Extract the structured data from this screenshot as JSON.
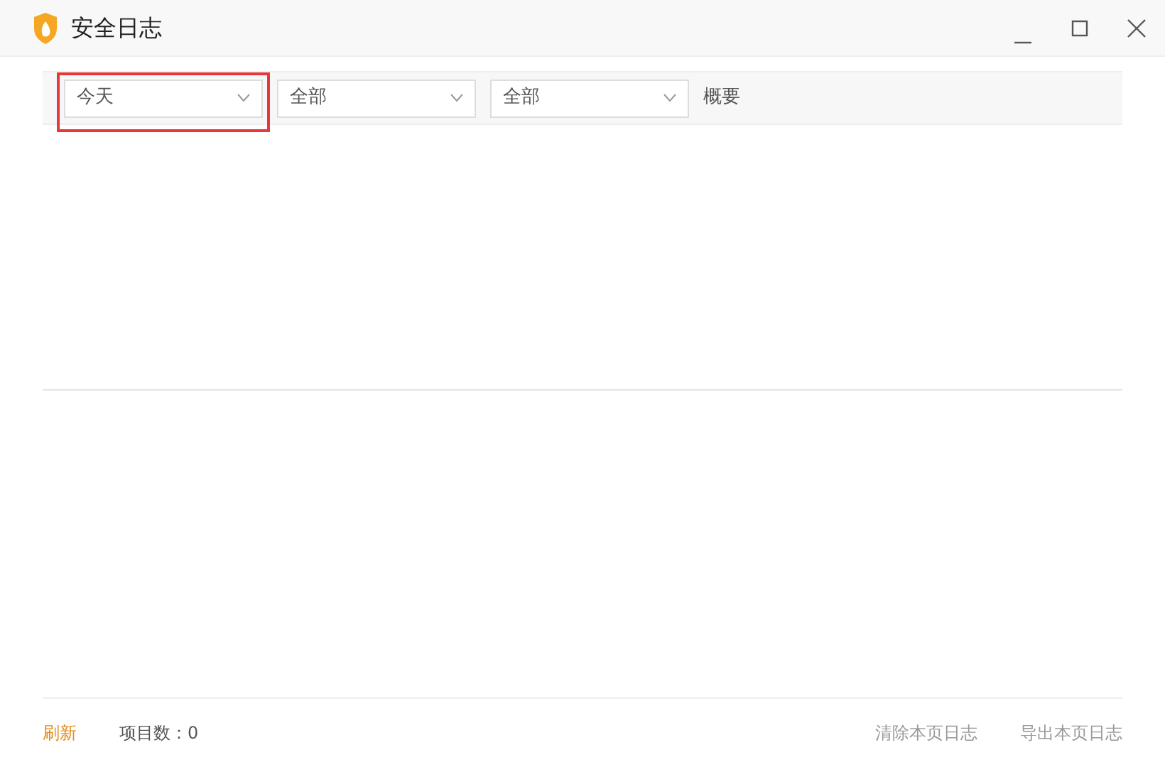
{
  "window": {
    "title": "安全日志"
  },
  "filters": [
    {
      "value": "今天",
      "highlighted": true
    },
    {
      "value": "全部",
      "highlighted": false
    },
    {
      "value": "全部",
      "highlighted": false
    }
  ],
  "column_header": "概要",
  "footer": {
    "refresh": "刷新",
    "count_label": "项目数：0",
    "actions": [
      "清除本页日志",
      "导出本页日志"
    ]
  }
}
